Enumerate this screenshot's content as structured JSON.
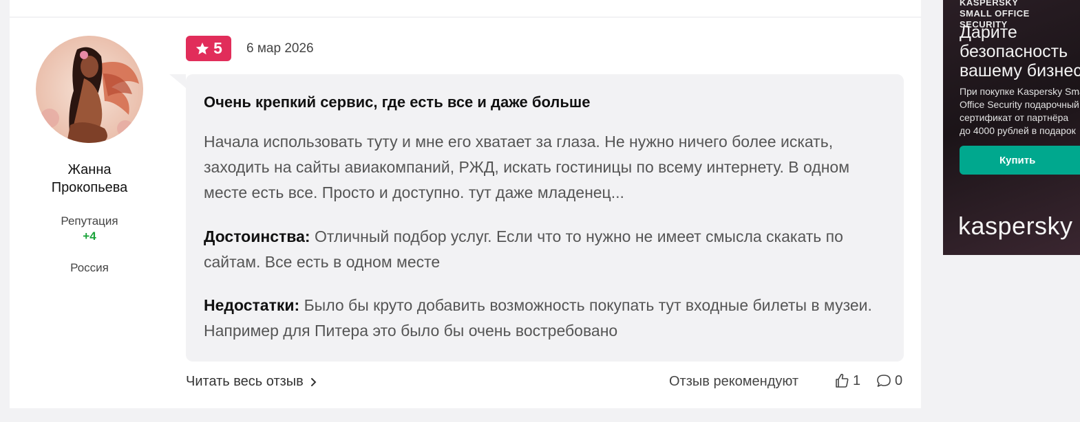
{
  "review": {
    "author": {
      "name_line1": "Жанна",
      "name_line2": "Прокопьева",
      "reputation_label": "Репутация",
      "reputation_value": "+4",
      "country": "Россия"
    },
    "rating": "5",
    "date": "6 мар 2026",
    "title": "Очень крепкий сервис, где есть все и даже больше",
    "body": "Начала использовать туту и мне его хватает за глаза. Не нужно ничего более искать, заходить на сайты авиакомпаний, РЖД, искать гостиницы по всему интернету. В одном месте есть все. Просто и доступно. тут даже младенец...",
    "pros_label": "Достоинства:",
    "pros_text": "Отличный подбор услуг. Если что то нужно не имеет смысла скакать по сайтам. Все есть в одном месте",
    "cons_label": "Недостатки:",
    "cons_text": "Было бы круто добавить возможность покупать тут входные билеты в музеи. Например для Питера это было бы очень востребовано",
    "read_more": "Читать весь отзыв",
    "recommend_label": "Отзыв рекомендуют",
    "likes": "1",
    "comments": "0"
  },
  "ad": {
    "brand_top": "KASPERSKY\nSMALL OFFICE SECURITY",
    "headline": "Дарите\nбезопасность\nвашему бизнесу",
    "desc": "При покупке Kaspersky Small\nOffice Security подарочный\nсертификат от партнёра\nдо 4000 рублей в подарок",
    "button": "Купить",
    "logo": "kaspersky"
  },
  "colors": {
    "rating_badge": "#e12d5a",
    "reputation": "#1aa33a",
    "ad_button": "#00a88e"
  }
}
